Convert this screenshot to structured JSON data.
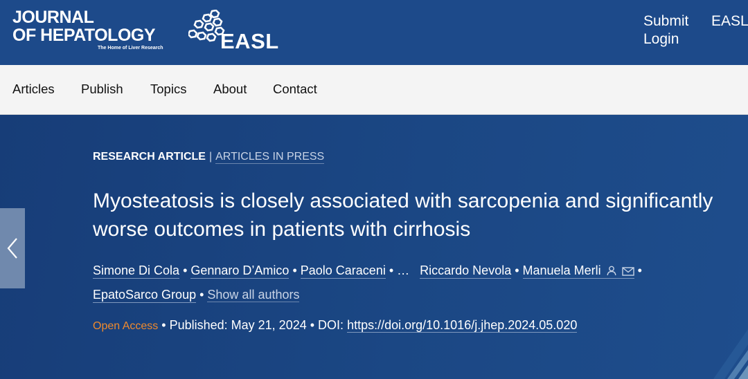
{
  "header": {
    "journal_line1": "JOURNAL",
    "journal_line2": "OF HEPATOLOGY",
    "tagline": "The Home of Liver Research",
    "partner_logo_text": "EASL",
    "submit_label": "Submit",
    "login_label": "Login",
    "easl_link_label": "EASL"
  },
  "nav": {
    "items": [
      "Articles",
      "Publish",
      "Topics",
      "About",
      "Contact"
    ]
  },
  "article": {
    "type_label": "RESEARCH ARTICLE",
    "separator": "|",
    "status_label": "ARTICLES IN PRESS",
    "title": "Myosteatosis is closely associated with sarcopenia and significantly worse outcomes in patients with cirrhosis",
    "authors": [
      "Simone Di Cola",
      "Gennaro D’Amico",
      "Paolo Caraceni",
      "…",
      "Riccardo Nevola",
      "Manuela Merli",
      "EpatoSarco Group"
    ],
    "show_all_label": "Show all authors",
    "access_label": "Open Access",
    "published_text": "Published: May 21, 2024",
    "doi_label": "DOI:",
    "doi_url": "https://doi.org/10.1016/j.jhep.2024.05.020"
  },
  "icons": {
    "prev": "chevron-left-icon",
    "corresponding": "person-icon",
    "email": "envelope-icon"
  },
  "colors": {
    "header_bg": "#1d4a8a",
    "hero_bg": "#1b4784",
    "nav_bg": "#f4f4f4",
    "open_access": "#ef8a2d"
  }
}
